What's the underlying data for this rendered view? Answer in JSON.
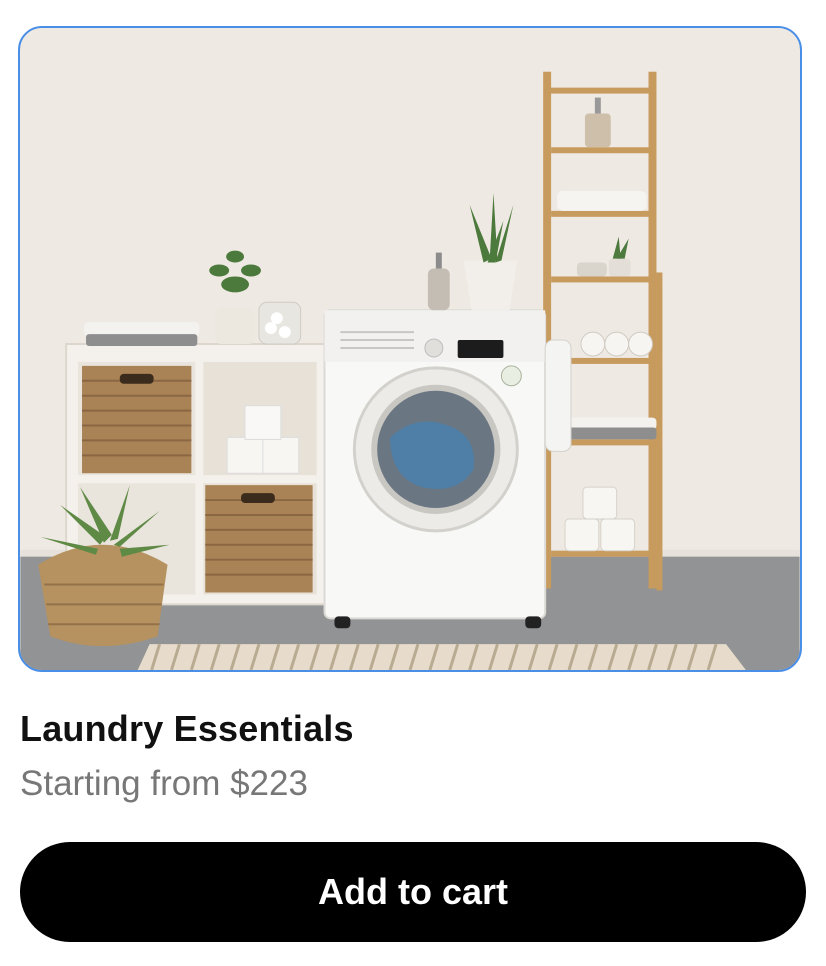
{
  "product": {
    "title": "Laundry Essentials",
    "price_text": "Starting from $223",
    "image_description_icon": "laundry-room-photo"
  },
  "actions": {
    "add_to_cart_label": "Add to cart"
  },
  "colors": {
    "image_border": "#4a8fe7",
    "button_bg": "#000000",
    "button_text": "#ffffff",
    "price_text": "#777777"
  }
}
